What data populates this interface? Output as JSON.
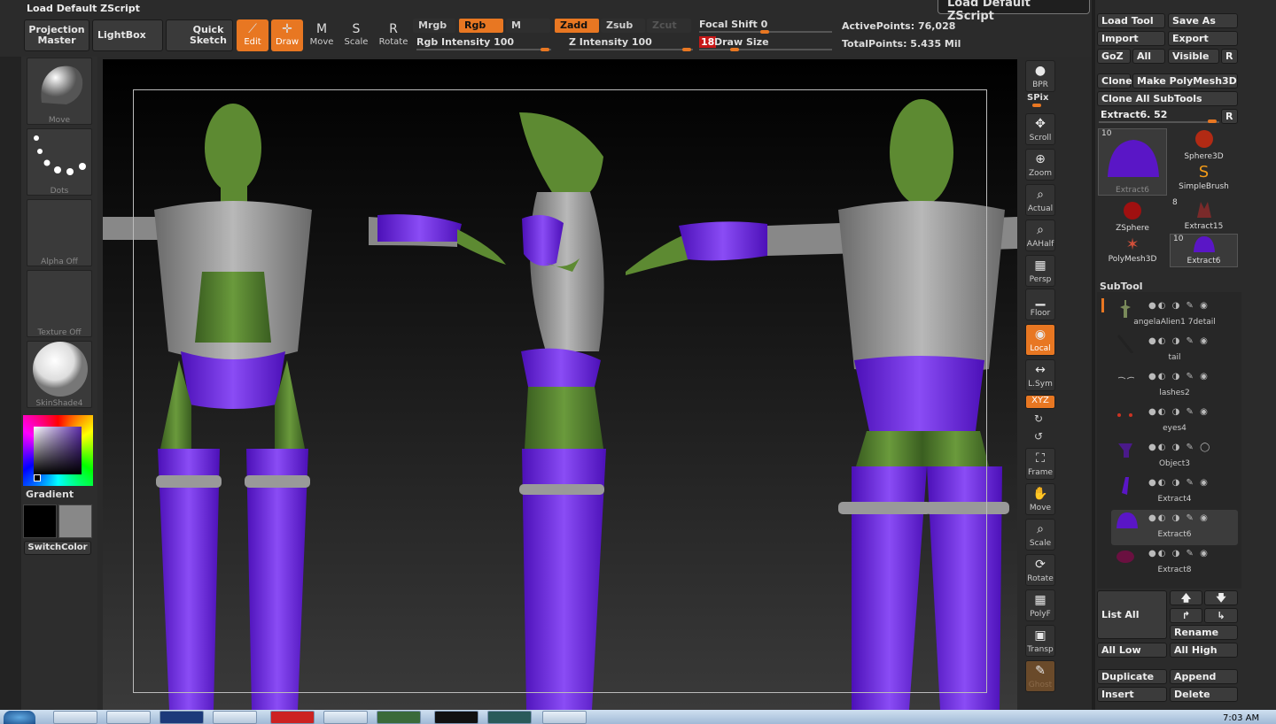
{
  "title_bar": {
    "script": "Load Default ZScript",
    "tooltip": "Load Default ZScript"
  },
  "top_buttons": {
    "projection_master": "Projection\nMaster",
    "lightbox": "LightBox",
    "quick_sketch": "Quick\nSketch"
  },
  "tools": [
    {
      "name": "Edit",
      "active": true
    },
    {
      "name": "Draw",
      "active": true
    },
    {
      "name": "Move",
      "active": false
    },
    {
      "name": "Scale",
      "active": false
    },
    {
      "name": "Rotate",
      "active": false
    }
  ],
  "color_modes": {
    "mrgb": "Mrgb",
    "rgb": "Rgb",
    "m": "M",
    "zadd": "Zadd",
    "zsub": "Zsub",
    "zcut": "Zcut"
  },
  "sliders": {
    "rgb_intensity": {
      "label": "Rgb Intensity 100",
      "value": 100
    },
    "z_intensity": {
      "label": "Z Intensity 100",
      "value": 100
    },
    "focal_shift": {
      "label": "Focal Shift 0",
      "value": 0
    },
    "draw_size": {
      "label": "Draw Size",
      "value": "18"
    }
  },
  "stats": {
    "active_points": "ActivePoints: 76,028",
    "total_points": "TotalPoints: 5.435 Mil"
  },
  "left_panel": {
    "brush": "Move",
    "stroke": "Dots",
    "alpha": "Alpha Off",
    "texture": "Texture Off",
    "material": "SkinShade4",
    "gradient": "Gradient",
    "switch_color": "SwitchColor"
  },
  "right_shelf": [
    {
      "label": "BPR",
      "icon": "bpr-icon"
    },
    {
      "label": "SPix",
      "icon": "spix-slider"
    },
    {
      "label": "Scroll",
      "icon": "scroll-icon"
    },
    {
      "label": "Zoom",
      "icon": "zoom-icon"
    },
    {
      "label": "Actual",
      "icon": "actual-icon"
    },
    {
      "label": "AAHalf",
      "icon": "aahalf-icon"
    },
    {
      "label": "Persp",
      "icon": "persp-icon"
    },
    {
      "label": "Floor",
      "icon": "floor-icon"
    },
    {
      "label": "Local",
      "icon": "local-icon",
      "active": true
    },
    {
      "label": "L.Sym",
      "icon": "lsym-icon"
    },
    {
      "label": "XYZ",
      "icon": "xyz-icon",
      "active": true
    },
    {
      "label": "Frame",
      "icon": "frame-icon"
    },
    {
      "label": "Move",
      "icon": "move-icon"
    },
    {
      "label": "Scale",
      "icon": "scale-icon"
    },
    {
      "label": "Rotate",
      "icon": "rotate-icon"
    },
    {
      "label": "PolyF",
      "icon": "polyf-icon"
    },
    {
      "label": "Transp",
      "icon": "transp-icon"
    },
    {
      "label": "Ghost",
      "icon": "ghost-icon"
    }
  ],
  "tool_panel": {
    "load_tool": "Load Tool",
    "save_as": "Save As",
    "import": "Import",
    "export": "Export",
    "goz": "GoZ",
    "all": "All",
    "visible": "Visible",
    "r": "R",
    "clone": "Clone",
    "make_polymesh": "Make PolyMesh3D",
    "clone_all": "Clone All SubTools",
    "current_tool": "Extract6. 52",
    "current_r": "R",
    "tools": [
      {
        "name": "Extract6",
        "count": "10"
      },
      {
        "name": "Sphere3D"
      },
      {
        "name": "SimpleBrush"
      },
      {
        "name": "ZSphere"
      },
      {
        "name": "Extract15",
        "count": "8"
      },
      {
        "name": "PolyMesh3D"
      },
      {
        "name": "Extract6",
        "count": "10"
      }
    ]
  },
  "subtool": {
    "title": "SubTool",
    "items": [
      {
        "name": "angelaAlien1 7detail",
        "selected": false
      },
      {
        "name": "tail",
        "selected": false
      },
      {
        "name": "lashes2",
        "selected": false
      },
      {
        "name": "eyes4",
        "selected": false
      },
      {
        "name": "Object3",
        "selected": false
      },
      {
        "name": "Extract4",
        "selected": false
      },
      {
        "name": "Extract6",
        "selected": true
      },
      {
        "name": "Extract8",
        "selected": false
      }
    ],
    "list_all": "List All",
    "rename": "Rename",
    "all_low": "All Low",
    "all_high": "All High",
    "duplicate": "Duplicate",
    "append": "Append",
    "insert": "Insert",
    "delete": "Delete"
  },
  "taskbar": {
    "clock": "7:03 AM"
  },
  "colors": {
    "accent": "#e87722",
    "purple": "#6a1fe0",
    "skin": "#4f7a2c",
    "armor": "#9a9a9a"
  }
}
